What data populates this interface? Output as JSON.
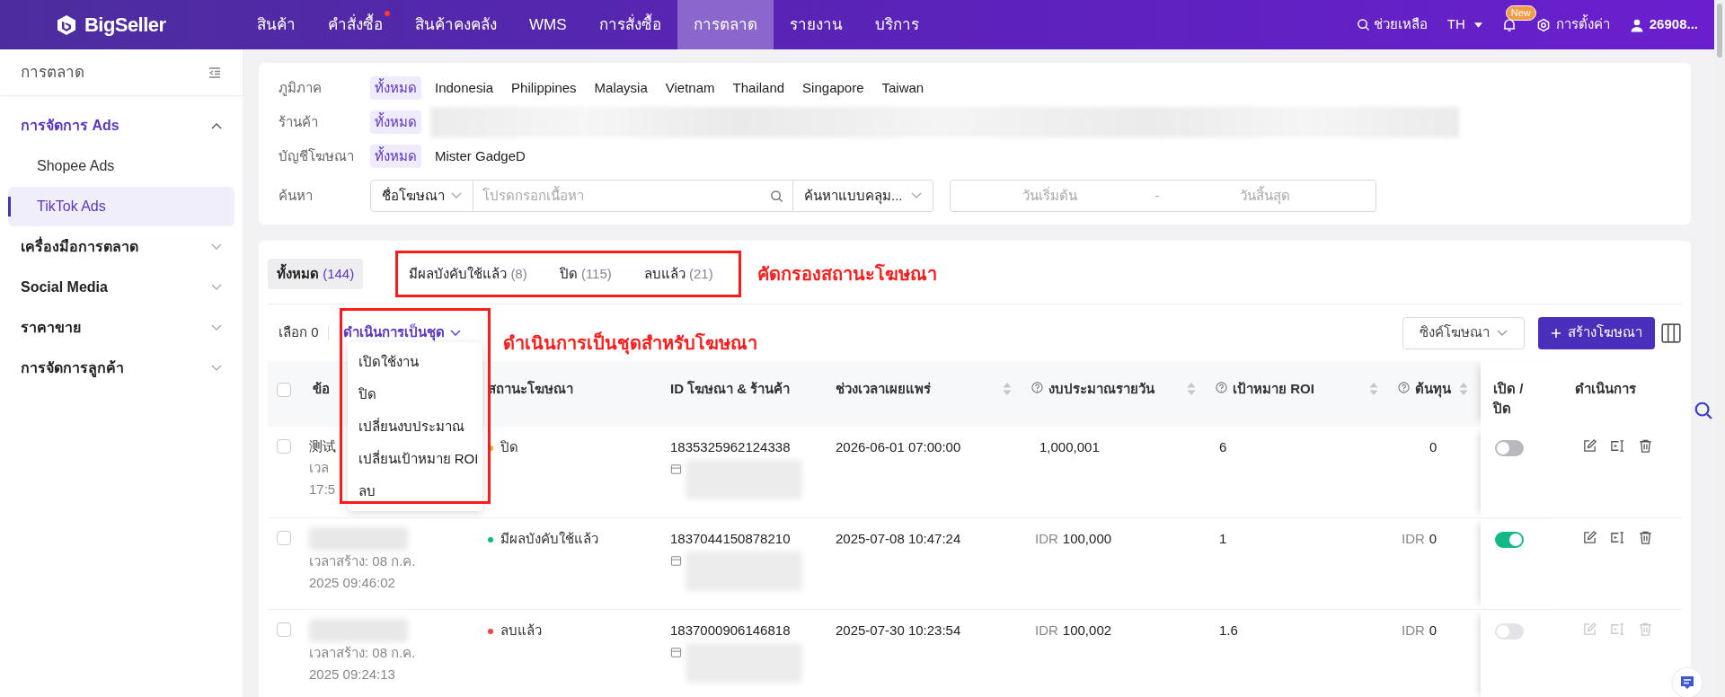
{
  "nav": {
    "logo": "BigSeller",
    "items": [
      {
        "label": "สินค้า",
        "selected": false,
        "dot": false
      },
      {
        "label": "คำสั่งซื้อ",
        "selected": false,
        "dot": true
      },
      {
        "label": "สินค้าคงคลัง",
        "selected": false,
        "dot": false
      },
      {
        "label": "WMS",
        "selected": false,
        "dot": false
      },
      {
        "label": "การสั่งซื้อ",
        "selected": false,
        "dot": false
      },
      {
        "label": "การตลาด",
        "selected": true,
        "dot": false
      },
      {
        "label": "รายงาน",
        "selected": false,
        "dot": false
      },
      {
        "label": "บริการ",
        "selected": false,
        "dot": false
      }
    ],
    "help": "ช่วยเหลือ",
    "lang": "TH",
    "new_badge": "New",
    "settings": "การตั้งค่า",
    "user": "26908..."
  },
  "sidebar": {
    "title": "การตลาด",
    "groups": [
      {
        "label": "การจัดการ Ads",
        "expanded": true,
        "active": true,
        "children": [
          {
            "label": "Shopee Ads",
            "selected": false
          },
          {
            "label": "TikTok Ads",
            "selected": true
          }
        ]
      },
      {
        "label": "เครื่องมือการตลาด",
        "expanded": false,
        "active": false
      },
      {
        "label": "Social Media",
        "expanded": false,
        "active": false
      },
      {
        "label": "ราคาขาย",
        "expanded": false,
        "active": false
      },
      {
        "label": "การจัดการลูกค้า",
        "expanded": false,
        "active": false
      }
    ]
  },
  "filters": {
    "rows": [
      {
        "label": "ภูมิภาค",
        "redacted": false,
        "options": [
          {
            "label": "ทั้งหมด",
            "selected": true
          },
          {
            "label": "Indonesia",
            "selected": false
          },
          {
            "label": "Philippines",
            "selected": false
          },
          {
            "label": "Malaysia",
            "selected": false
          },
          {
            "label": "Vietnam",
            "selected": false
          },
          {
            "label": "Thailand",
            "selected": false
          },
          {
            "label": "Singapore",
            "selected": false
          },
          {
            "label": "Taiwan",
            "selected": false
          }
        ]
      },
      {
        "label": "ร้านค้า",
        "redacted": true,
        "options": [
          {
            "label": "ทั้งหมด",
            "selected": true
          }
        ]
      },
      {
        "label": "บัญชีโฆษณา",
        "redacted": false,
        "options": [
          {
            "label": "ทั้งหมด",
            "selected": true
          },
          {
            "label": "Mister GadgeD",
            "selected": false
          }
        ]
      }
    ],
    "search": {
      "label": "ค้นหา",
      "field_select": "ชื่อโฆษณา",
      "placeholder": "โปรดกรอกเนื้อหา",
      "mode": "ค้นหาแบบคลุม...",
      "start_placeholder": "วันเริ่มต้น",
      "separator": "-",
      "end_placeholder": "วันสิ้นสุด"
    }
  },
  "status_tabs": [
    {
      "label": "ทั้งหมด",
      "count": "(144)",
      "selected": true
    },
    {
      "label": "มีผลบังคับใช้แล้ว",
      "count": "(8)",
      "selected": false
    },
    {
      "label": "ปิด",
      "count": "(115)",
      "selected": false
    },
    {
      "label": "ลบแล้ว",
      "count": "(21)",
      "selected": false
    }
  ],
  "annotations": [
    {
      "text": "คัดกรองสถานะโฆษณา"
    },
    {
      "text": "ดำเนินการเป็นชุดสำหรับโฆษณา"
    }
  ],
  "toolbar": {
    "selected_count": "เลือก 0",
    "batch": "ดำเนินการเป็นชุด",
    "batch_menu": [
      "เปิดใช้งาน",
      "ปิด",
      "เปลี่ยนงบประมาณ",
      "เปลี่ยนเป้าหมาย ROI",
      "ลบ"
    ],
    "sync": "ซิงค์โฆษณา",
    "create": "สร้างโฆษณา"
  },
  "table": {
    "all_checked": false,
    "columns": [
      {
        "label": "ข้อ"
      },
      {
        "label": "สถานะโฆษณา",
        "help": false,
        "sortable": false
      },
      {
        "label": "ID โฆษณา & ร้านค้า",
        "help": false,
        "sortable": false
      },
      {
        "label": "ช่วงเวลาเผยแพร่",
        "help": false,
        "sortable": true
      },
      {
        "label": "งบประมาณรายวัน",
        "help": true,
        "sortable": true
      },
      {
        "label": "เป้าหมาย ROI",
        "help": true,
        "sortable": true
      },
      {
        "label": "ต้นทุน",
        "help": true,
        "sortable": true
      },
      {
        "label": "เปิด / ปิด",
        "help": false,
        "sortable": false
      },
      {
        "label": "ดำเนินการ",
        "help": false,
        "sortable": false
      }
    ],
    "rows": [
      {
        "name": "测试",
        "redacted": false,
        "created_lines": [
          "เวล",
          "17:5"
        ],
        "checked": false,
        "status": "ปิด",
        "color": "#f5a623",
        "ad_id": "1835325962124338",
        "period": "2026-06-01 07:00:00",
        "budget": "1,000,001",
        "roi": "6",
        "cost": "0",
        "on": false,
        "disabled": false
      },
      {
        "redacted": true,
        "created_lines": [
          "เวลาสร้าง: 08 ก.ค.",
          "2025 09:46:02"
        ],
        "checked": false,
        "status": "มีผลบังคับใช้แล้ว",
        "color": "#10b981",
        "ad_id": "1837044150878210",
        "period": "2025-07-08 10:47:24",
        "budget_currency": "IDR",
        "budget": "100,000",
        "roi": "1",
        "cost_currency": "IDR",
        "cost": "0",
        "on": true,
        "disabled": false
      },
      {
        "redacted": true,
        "created_lines": [
          "เวลาสร้าง: 08 ก.ค.",
          "2025 09:24:13"
        ],
        "checked": false,
        "status": "ลบแล้ว",
        "color": "#ef4444",
        "ad_id": "1837000906146818",
        "period": "2025-07-30 10:23:54",
        "budget_currency": "IDR",
        "budget": "100,002",
        "roi": "1.6",
        "cost_currency": "IDR",
        "cost": "0",
        "on": false,
        "disabled": true
      }
    ]
  }
}
